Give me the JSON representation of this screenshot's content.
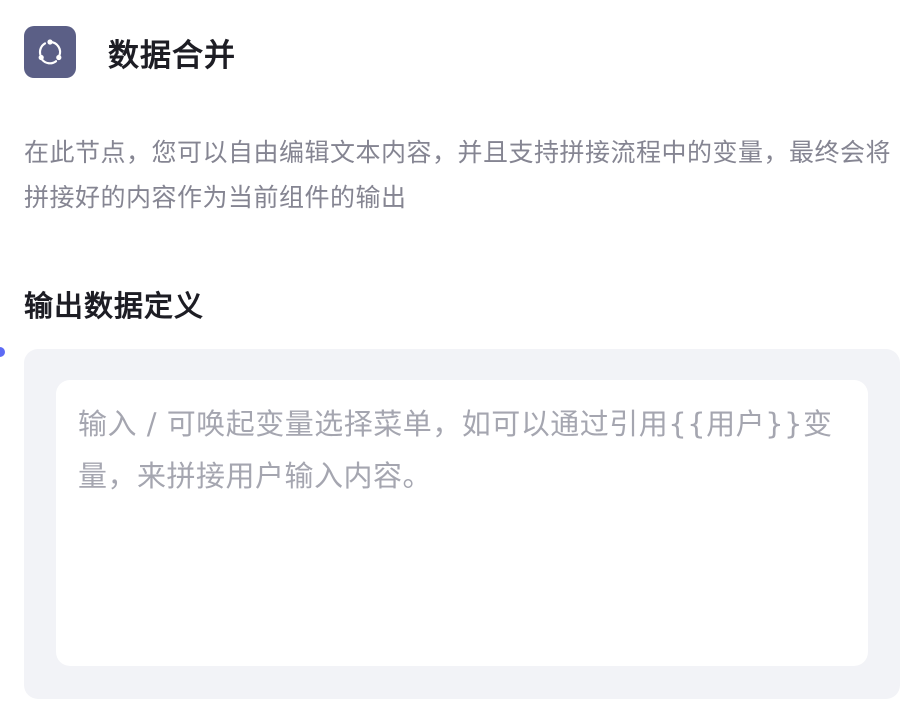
{
  "node": {
    "icon": "loop-arrows-icon",
    "title": "数据合并",
    "description": "在此节点，您可以自由编辑文本内容，并且支持拼接流程中的变量，最终会将拼接好的内容作为当前组件的输出"
  },
  "output_definition": {
    "label": "输出数据定义",
    "editor_placeholder": "输入 / 可唤起变量选择菜单，如可以通过引用{{用户}}变量，来拼接用户输入内容。",
    "editor_value": ""
  },
  "colors": {
    "icon_background": "#5b5f86",
    "panel_background": "#f2f3f7",
    "connector_dot": "#5d6bf5"
  }
}
